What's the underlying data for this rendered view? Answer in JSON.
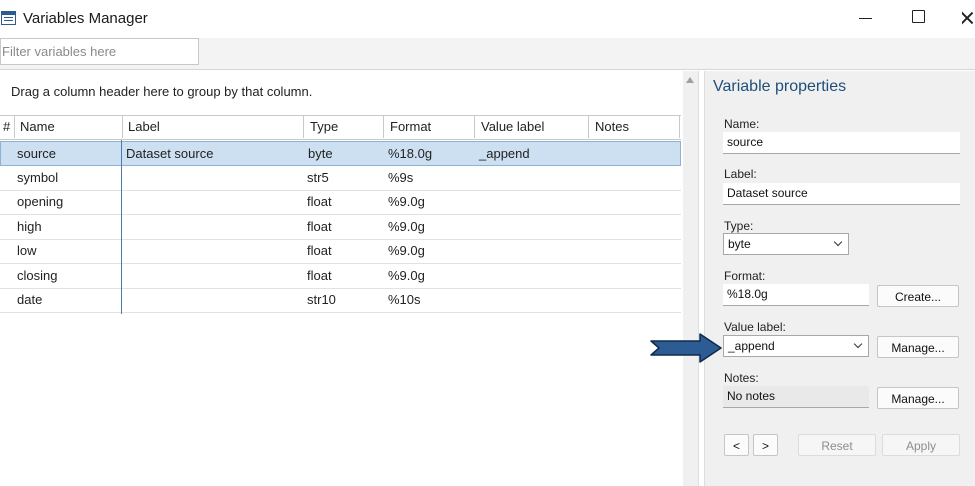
{
  "window": {
    "title": "Variables Manager",
    "icon": "variables-manager-icon"
  },
  "filter": {
    "placeholder": "Filter variables here",
    "value": ""
  },
  "grid": {
    "group_hint": "Drag a column header here to group by that column.",
    "columns": [
      "#",
      "Name",
      "Label",
      "Type",
      "Format",
      "Value label",
      "Notes"
    ],
    "rows": [
      {
        "name": "source",
        "label": "Dataset source",
        "type": "byte",
        "format": "%18.0g",
        "value_label": "_append",
        "notes": "",
        "selected": true
      },
      {
        "name": "symbol",
        "label": "",
        "type": "str5",
        "format": "%9s",
        "value_label": "",
        "notes": ""
      },
      {
        "name": "opening",
        "label": "",
        "type": "float",
        "format": "%9.0g",
        "value_label": "",
        "notes": ""
      },
      {
        "name": "high",
        "label": "",
        "type": "float",
        "format": "%9.0g",
        "value_label": "",
        "notes": ""
      },
      {
        "name": "low",
        "label": "",
        "type": "float",
        "format": "%9.0g",
        "value_label": "",
        "notes": ""
      },
      {
        "name": "closing",
        "label": "",
        "type": "float",
        "format": "%9.0g",
        "value_label": "",
        "notes": ""
      },
      {
        "name": "date",
        "label": "",
        "type": "str10",
        "format": "%10s",
        "value_label": "",
        "notes": ""
      }
    ]
  },
  "properties": {
    "title": "Variable properties",
    "name_label": "Name:",
    "name_value": "source",
    "label_label": "Label:",
    "label_value": "Dataset source",
    "type_label": "Type:",
    "type_value": "byte",
    "format_label": "Format:",
    "format_value": "%18.0g",
    "create_button": "Create...",
    "value_label_label": "Value label:",
    "value_label_value": "_append",
    "manage_value_label_button": "Manage...",
    "notes_label": "Notes:",
    "notes_value": "No notes",
    "manage_notes_button": "Manage...",
    "prev_button": "<",
    "next_button": ">",
    "reset_button": "Reset",
    "apply_button": "Apply"
  },
  "colors": {
    "accent_title": "#1f4e79",
    "selection_bg": "#cce0f2",
    "arrow_fill": "#2c5c93"
  }
}
